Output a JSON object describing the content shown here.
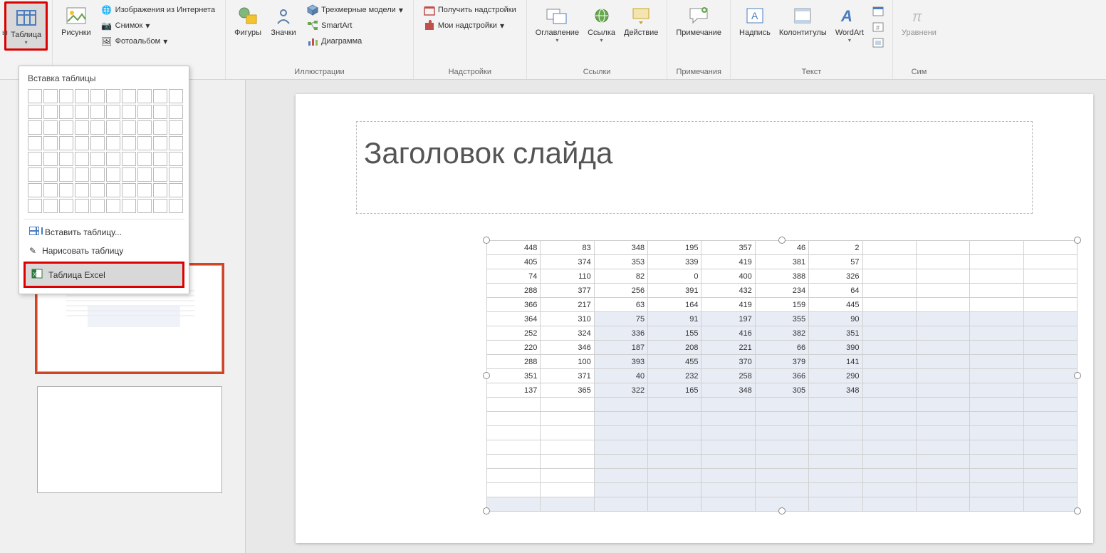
{
  "ribbon": {
    "table": "Таблица",
    "pictures": "Рисунки",
    "online_images": "Изображения из Интернета",
    "screenshot": "Снимок",
    "photo_album": "Фотоальбом",
    "shapes": "Фигуры",
    "icons": "Значки",
    "models3d": "Трехмерные модели",
    "smartart": "SmartArt",
    "chart": "Диаграмма",
    "group_illustrations": "Иллюстрации",
    "get_addins": "Получить надстройки",
    "my_addins": "Мои надстройки",
    "group_addins": "Надстройки",
    "zoom": "Оглавление",
    "link": "Ссылка",
    "action": "Действие",
    "group_links": "Ссылки",
    "comment": "Примечание",
    "group_comments": "Примечания",
    "textbox": "Надпись",
    "header_footer": "Колонтитулы",
    "wordart": "WordArt",
    "group_text": "Текст",
    "equation": "Уравнени",
    "group_sym": "Сим"
  },
  "dropdown": {
    "title": "Вставка таблицы",
    "insert": "Вставить таблицу...",
    "draw": "Нарисовать таблицу",
    "excel": "Таблица Excel"
  },
  "slide": {
    "title": "Заголовок слайда"
  },
  "table_data": {
    "rows": [
      [
        448,
        83,
        348,
        195,
        357,
        46,
        2
      ],
      [
        405,
        374,
        353,
        339,
        419,
        381,
        57
      ],
      [
        74,
        110,
        82,
        0,
        400,
        388,
        326
      ],
      [
        288,
        377,
        256,
        391,
        432,
        234,
        64
      ],
      [
        366,
        217,
        63,
        164,
        419,
        159,
        445
      ],
      [
        364,
        310,
        75,
        91,
        197,
        355,
        90
      ],
      [
        252,
        324,
        336,
        155,
        416,
        382,
        351
      ],
      [
        220,
        346,
        187,
        208,
        221,
        66,
        390
      ],
      [
        288,
        100,
        393,
        455,
        370,
        379,
        141
      ],
      [
        351,
        371,
        40,
        232,
        258,
        366,
        290
      ],
      [
        137,
        365,
        322,
        165,
        348,
        305,
        348
      ]
    ],
    "total_cols": 11,
    "empty_rows_after": 7,
    "blue_extra_row": true,
    "blue_col_start": 2,
    "blue_row_start": 5
  },
  "truncated_left": "ы"
}
